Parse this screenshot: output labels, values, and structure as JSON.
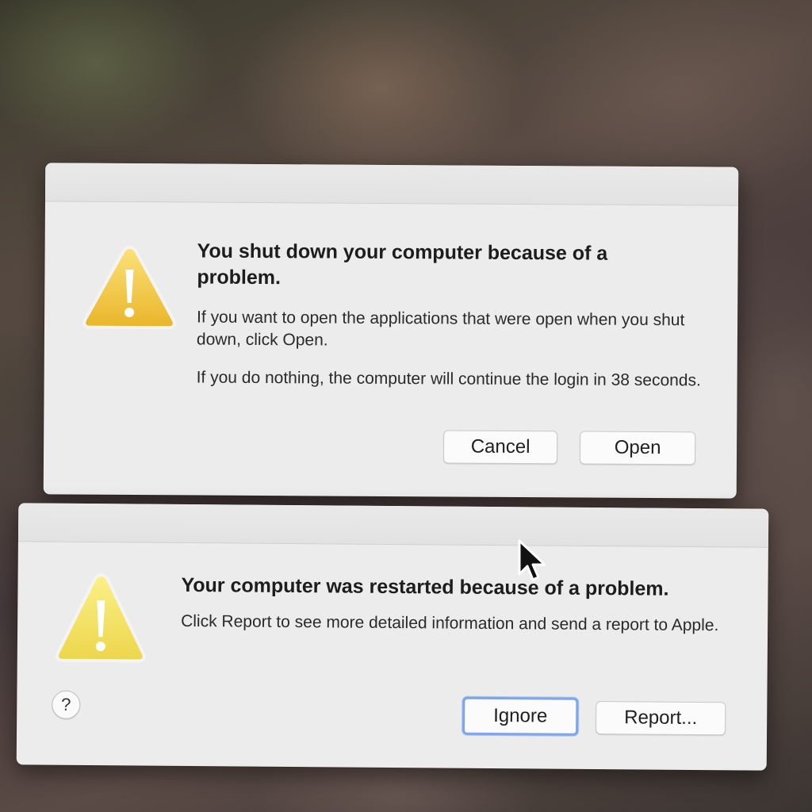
{
  "shutdown_dialog": {
    "title": "You shut down your computer because of a problem.",
    "message_1": "If you want to open the applications that were open when you shut down, click Open.",
    "message_2": "If you do nothing, the computer will continue the login in 38 seconds.",
    "cancel_label": "Cancel",
    "open_label": "Open",
    "icon": "warning-icon"
  },
  "restart_dialog": {
    "title": "Your computer was restarted because of a problem.",
    "message": "Click Report to see more detailed information and send a report to Apple.",
    "help_label": "?",
    "ignore_label": "Ignore",
    "report_label": "Report...",
    "icon": "warning-icon"
  },
  "colors": {
    "dialog_bg": "#ececec",
    "focus_ring": "#7fa6e8",
    "warning_yellow": "#f2c94c"
  }
}
